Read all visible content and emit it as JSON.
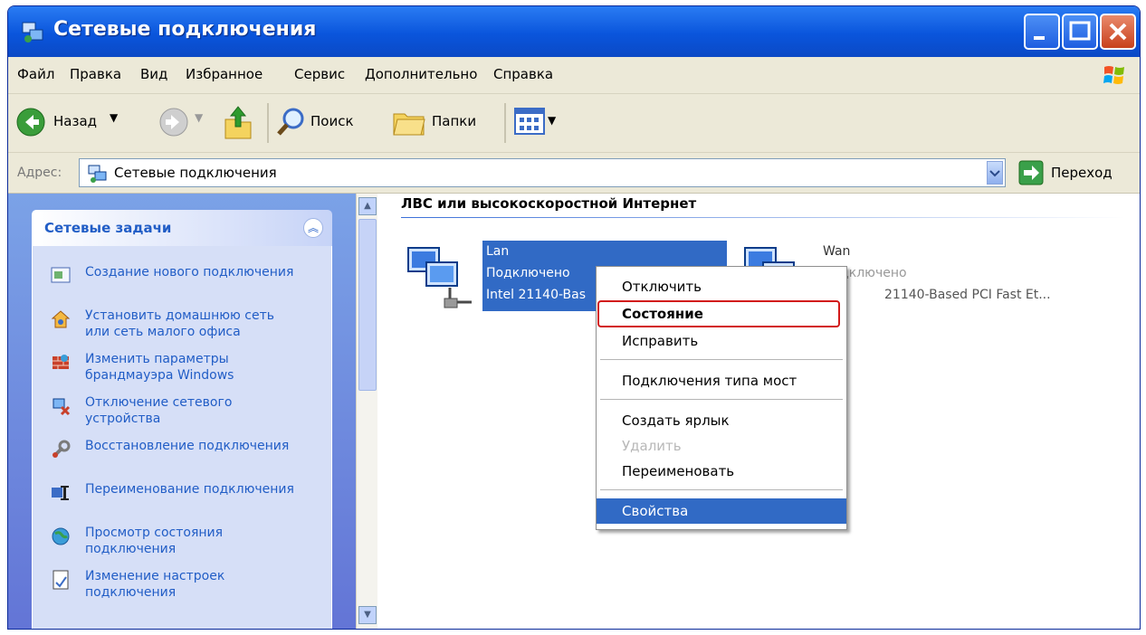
{
  "window": {
    "title": "Сетевые подключения"
  },
  "menubar": {
    "items": [
      "Файл",
      "Правка",
      "Вид",
      "Избранное",
      "Сервис",
      "Дополнительно",
      "Справка"
    ]
  },
  "toolbar": {
    "back": "Назад",
    "search": "Поиск",
    "folders": "Папки"
  },
  "address": {
    "label": "Адрес:",
    "value": "Сетевые подключения",
    "go": "Переход"
  },
  "tasks": {
    "title": "Сетевые задачи",
    "items": [
      {
        "label": "Создание нового подключения"
      },
      {
        "label": "Установить домашнюю сеть или сеть малого офиса"
      },
      {
        "label": "Изменить параметры брандмауэра Windows"
      },
      {
        "label": "Отключение сетевого устройства"
      },
      {
        "label": "Восстановление подключения"
      },
      {
        "label": "Переименование подключения"
      },
      {
        "label": "Просмотр состояния подключения"
      },
      {
        "label": "Изменение настроек подключения"
      }
    ]
  },
  "content": {
    "group_header": "ЛВС или высокоскоростной Интернет",
    "connections": [
      {
        "name": "Lan",
        "status": "Подключено",
        "device": "Intel 21140-Bas"
      },
      {
        "name": "Wan",
        "status": "Подключено",
        "device": "21140-Based PCI Fast Et..."
      }
    ]
  },
  "context_menu": {
    "items": [
      "Отключить",
      "Состояние",
      "Исправить",
      "Подключения типа мост",
      "Создать ярлык",
      "Удалить",
      "Переименовать",
      "Свойства"
    ]
  },
  "colors": {
    "title_bar": "#0a55dc",
    "selection": "#316ac5",
    "annotation": "#d21a1a"
  }
}
